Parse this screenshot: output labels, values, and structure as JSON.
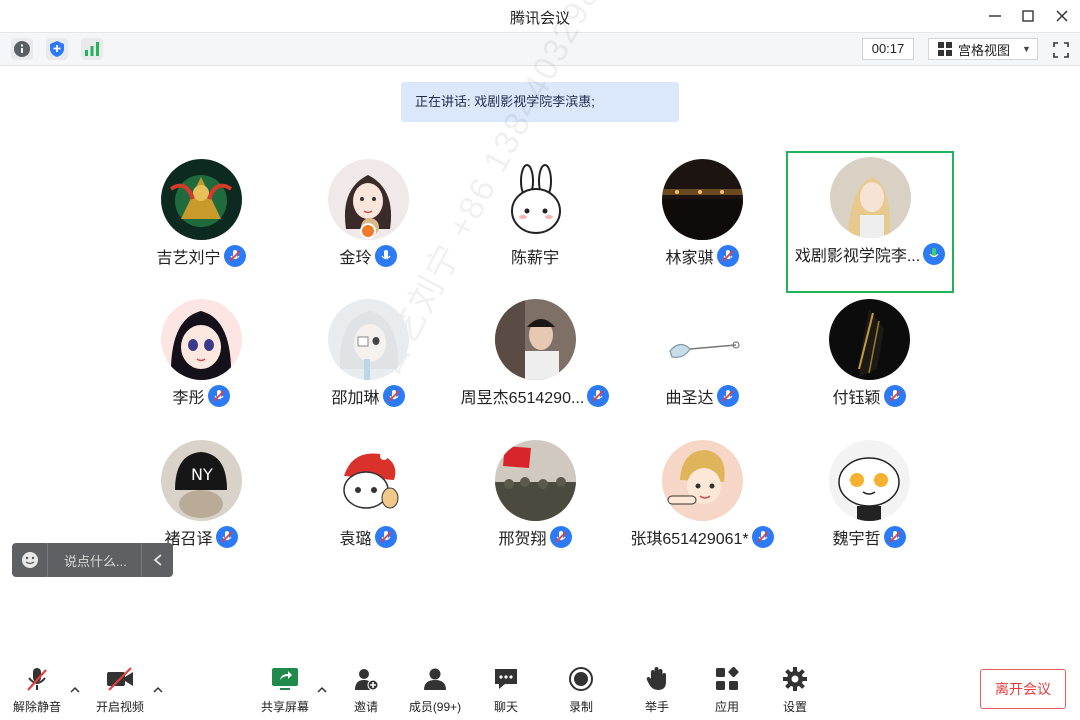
{
  "window": {
    "title": "腾讯会议"
  },
  "toolbar": {
    "timer": "00:17",
    "view_label": "宫格视图"
  },
  "speaking": {
    "label": "正在讲话: 戏剧影视学院李滨惠;"
  },
  "watermark": "吉艺刘宁 +86 13844032986",
  "participants": [
    {
      "name": "吉艺刘宁",
      "mic": "muted"
    },
    {
      "name": "金玲",
      "mic": "muted",
      "host": true
    },
    {
      "name": "陈薪宇",
      "mic": "none"
    },
    {
      "name": "林家骐",
      "mic": "muted"
    },
    {
      "name": "戏剧影视学院李...",
      "mic": "talking",
      "active": true
    },
    {
      "name": "李彤",
      "mic": "muted"
    },
    {
      "name": "邵加琳",
      "mic": "muted"
    },
    {
      "name": "周昱杰6514290...",
      "mic": "muted"
    },
    {
      "name": "曲圣达",
      "mic": "muted"
    },
    {
      "name": "付钰颖",
      "mic": "muted"
    },
    {
      "name": "褚召译",
      "mic": "muted"
    },
    {
      "name": "袁璐",
      "mic": "muted"
    },
    {
      "name": "邢贺翔",
      "mic": "muted"
    },
    {
      "name": "张琪651429061*",
      "mic": "muted"
    },
    {
      "name": "魏宇哲",
      "mic": "muted"
    }
  ],
  "chat": {
    "placeholder": "说点什么..."
  },
  "bottom": {
    "unmute": "解除静音",
    "start_video": "开启视频",
    "share_screen": "共享屏幕",
    "invite": "邀请",
    "members": "成员(99+)",
    "chat": "聊天",
    "record": "录制",
    "raise_hand": "举手",
    "apps": "应用",
    "settings": "设置",
    "leave": "离开会议"
  },
  "colors": {
    "accent": "#2d7af6",
    "active_border": "#21b35b",
    "leave": "#e53e3e",
    "muted_red": "#e53e3e"
  }
}
